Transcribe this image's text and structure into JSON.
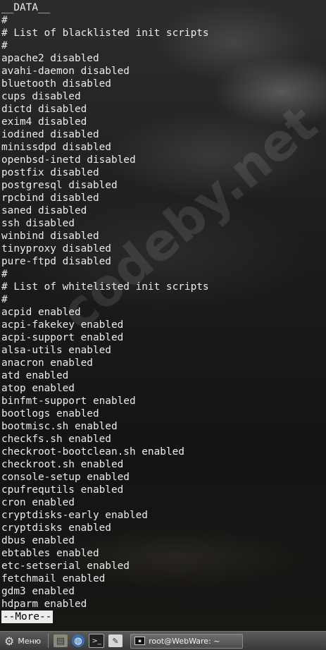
{
  "terminal": {
    "lines": [
      "__DATA__",
      "#",
      "# List of blacklisted init scripts",
      "#",
      "apache2 disabled",
      "avahi-daemon disabled",
      "bluetooth disabled",
      "cups disabled",
      "dictd disabled",
      "exim4 disabled",
      "iodined disabled",
      "minissdpd disabled",
      "openbsd-inetd disabled",
      "postfix disabled",
      "postgresql disabled",
      "rpcbind disabled",
      "saned disabled",
      "ssh disabled",
      "winbind disabled",
      "tinyproxy disabled",
      "pure-ftpd disabled",
      "#",
      "# List of whitelisted init scripts",
      "#",
      "acpid enabled",
      "acpi-fakekey enabled",
      "acpi-support enabled",
      "alsa-utils enabled",
      "anacron enabled",
      "atd enabled",
      "atop enabled",
      "binfmt-support enabled",
      "bootlogs enabled",
      "bootmisc.sh enabled",
      "checkfs.sh enabled",
      "checkroot-bootclean.sh enabled",
      "checkroot.sh enabled",
      "console-setup enabled",
      "cpufrequtils enabled",
      "cron enabled",
      "cryptdisks-early enabled",
      "cryptdisks enabled",
      "dbus enabled",
      "ebtables enabled",
      "etc-setserial enabled",
      "fetchmail enabled",
      "gdm3 enabled",
      "hdparm enabled"
    ],
    "more_prompt": "--More--",
    "colors": {
      "text": "#ececec",
      "prompt_bg": "#ececec",
      "prompt_text": "#000000"
    }
  },
  "watermark": "codeby.net",
  "taskbar": {
    "menu_icon": "gear-icon",
    "menu_label": "Меню",
    "launchers": [
      {
        "name": "file-manager-icon",
        "glyph": "▤"
      },
      {
        "name": "web-browser-icon",
        "glyph": "◍"
      },
      {
        "name": "terminal-icon",
        "glyph": ">_"
      },
      {
        "name": "text-editor-icon",
        "glyph": "✎"
      }
    ],
    "active_task": {
      "icon": "terminal-icon",
      "label": "root@WebWare: ~"
    }
  }
}
